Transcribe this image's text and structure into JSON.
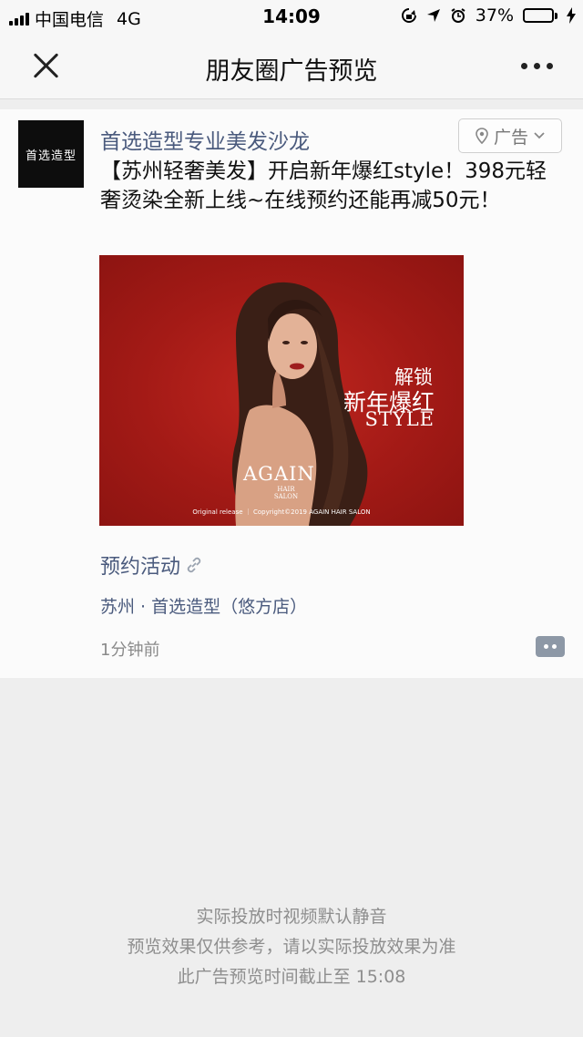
{
  "status_bar": {
    "carrier": "中国电信",
    "network": "4G",
    "time": "14:09",
    "battery_percent": "37%",
    "battery_level": 0.37
  },
  "nav": {
    "title": "朋友圈广告预览",
    "close_icon": "close-icon",
    "more_icon": "more-icon"
  },
  "ad": {
    "avatar_text": "首选造型",
    "advertiser": "首选造型专业美发沙龙",
    "tag_label": "广告",
    "text": "【苏州轻奢美发】开启新年爆红style！398元轻奢烫染全新上线~在线预约还能再减50元！",
    "image": {
      "line1": "解锁",
      "line2": "新年爆红",
      "line3": "STYLE",
      "brand": "AGAIN",
      "brand_sub": "HAIR SALON",
      "copyright": "Original release ｜ Copyright©2019 AGAIN HAIR SALON"
    },
    "booking_link": "预约活动",
    "location": "苏州 · 首选造型（悠方店）",
    "time_ago": "1分钟前"
  },
  "notes": [
    "实际投放时视频默认静音",
    "预览效果仅供参考，请以实际投放效果为准",
    "此广告预览时间截止至 15:08"
  ],
  "colors": {
    "link_blue": "#4a5a7d",
    "ad_red": "#a31a16",
    "background": "#eeeeee"
  }
}
